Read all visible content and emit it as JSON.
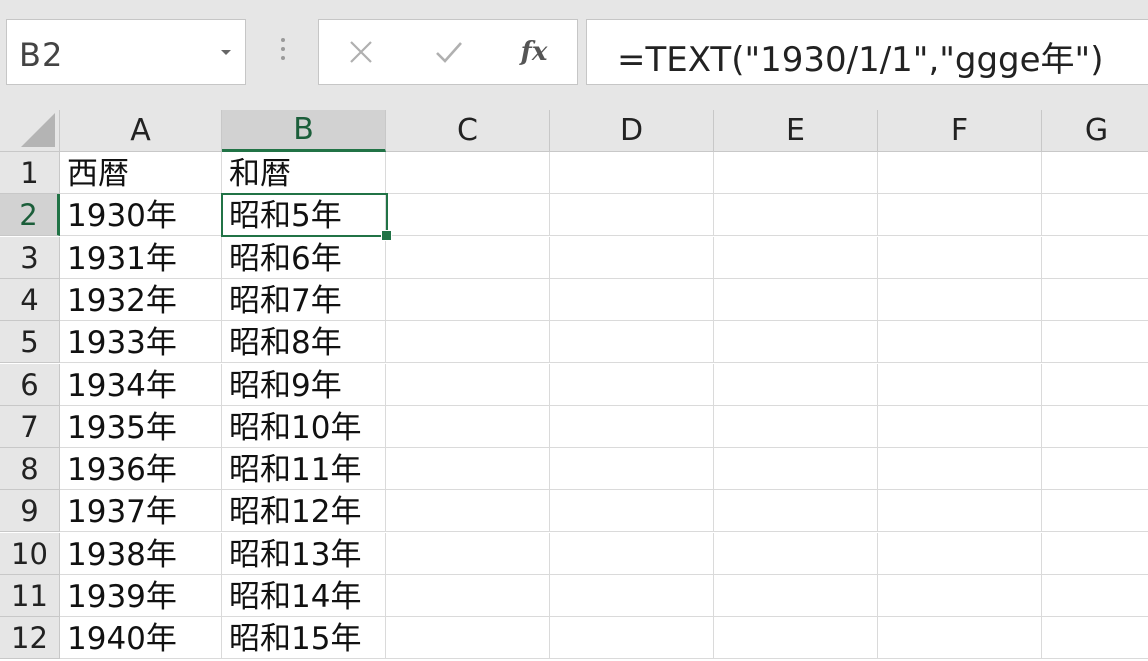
{
  "name_box": {
    "value": "B2"
  },
  "formula_bar": {
    "value": "=TEXT(\"1930/1/1\",\"ggge年\")",
    "fx_label": "fx"
  },
  "icons": {
    "cancel": "close-icon",
    "enter": "check-icon",
    "function": "fx-icon",
    "menu": "more-vertical-icon"
  },
  "colors": {
    "accent": "#217346",
    "header_bg": "#e6e6e6"
  },
  "columns": [
    "A",
    "B",
    "C",
    "D",
    "E",
    "F",
    "G"
  ],
  "selected_cell": {
    "column": "B",
    "row": "2"
  },
  "rows": [
    {
      "num": "1",
      "a": "西暦",
      "b": "和暦"
    },
    {
      "num": "2",
      "a": "1930年",
      "b": "昭和5年"
    },
    {
      "num": "3",
      "a": "1931年",
      "b": "昭和6年"
    },
    {
      "num": "4",
      "a": "1932年",
      "b": "昭和7年"
    },
    {
      "num": "5",
      "a": "1933年",
      "b": "昭和8年"
    },
    {
      "num": "6",
      "a": "1934年",
      "b": "昭和9年"
    },
    {
      "num": "7",
      "a": "1935年",
      "b": "昭和10年"
    },
    {
      "num": "8",
      "a": "1936年",
      "b": "昭和11年"
    },
    {
      "num": "9",
      "a": "1937年",
      "b": "昭和12年"
    },
    {
      "num": "10",
      "a": "1938年",
      "b": "昭和13年"
    },
    {
      "num": "11",
      "a": "1939年",
      "b": "昭和14年"
    },
    {
      "num": "12",
      "a": "1940年",
      "b": "昭和15年"
    }
  ]
}
